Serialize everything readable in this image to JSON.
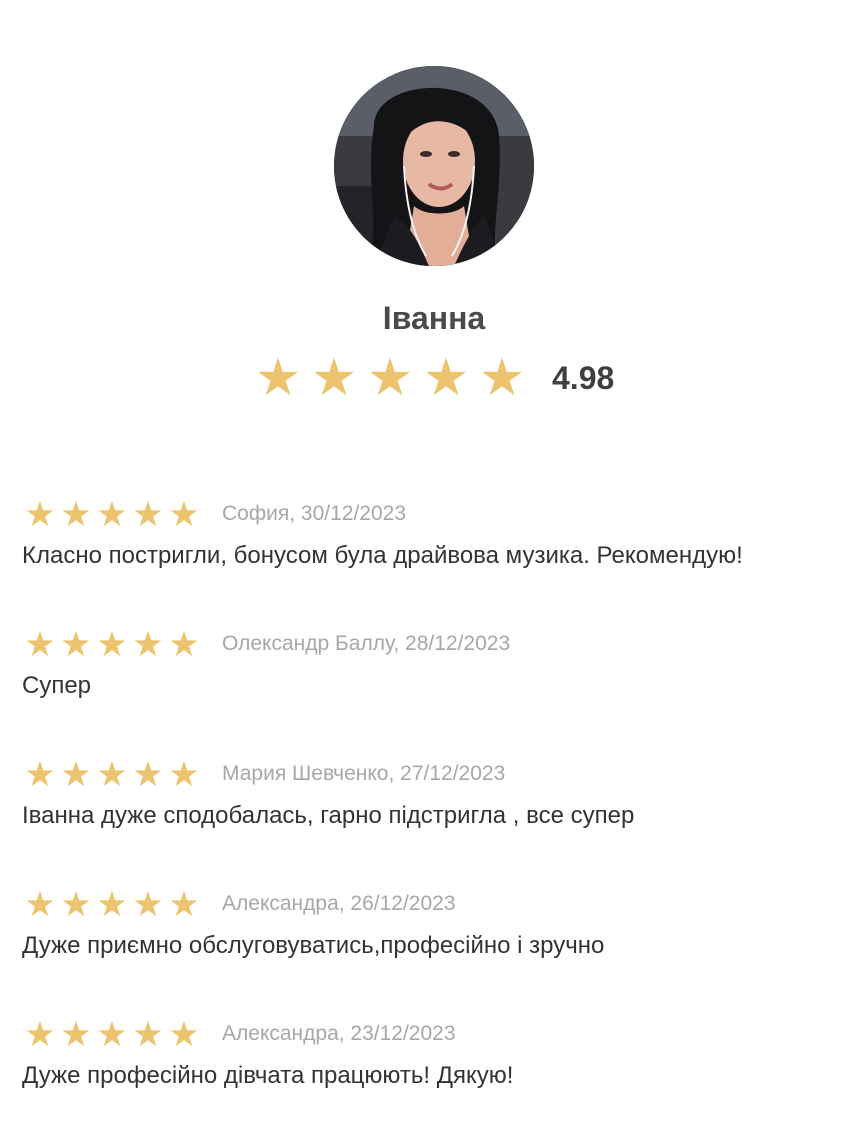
{
  "profile": {
    "name": "Іванна",
    "rating": "4.98",
    "stars_filled": 5,
    "avatar": "portrait-photo-icon"
  },
  "colors": {
    "star": "#ecc46f",
    "author": "#a7a7a7",
    "text": "#333333"
  },
  "reviews": [
    {
      "stars": 5,
      "author": "София, 30/12/2023",
      "text": "Класно постригли, бонусом була драйвова музика. Рекомендую!"
    },
    {
      "stars": 5,
      "author": "Олександр Баллу, 28/12/2023",
      "text": "Супер"
    },
    {
      "stars": 5,
      "author": "Мария Шевченко, 27/12/2023",
      "text": "Іванна дуже сподобалась, гарно підстригла , все супер"
    },
    {
      "stars": 5,
      "author": "Александра, 26/12/2023",
      "text": "Дуже приємно обслуговуватись,професійно і зручно"
    },
    {
      "stars": 5,
      "author": "Александра, 23/12/2023",
      "text": "Дуже професійно дівчата працюють! Дякую!"
    }
  ]
}
